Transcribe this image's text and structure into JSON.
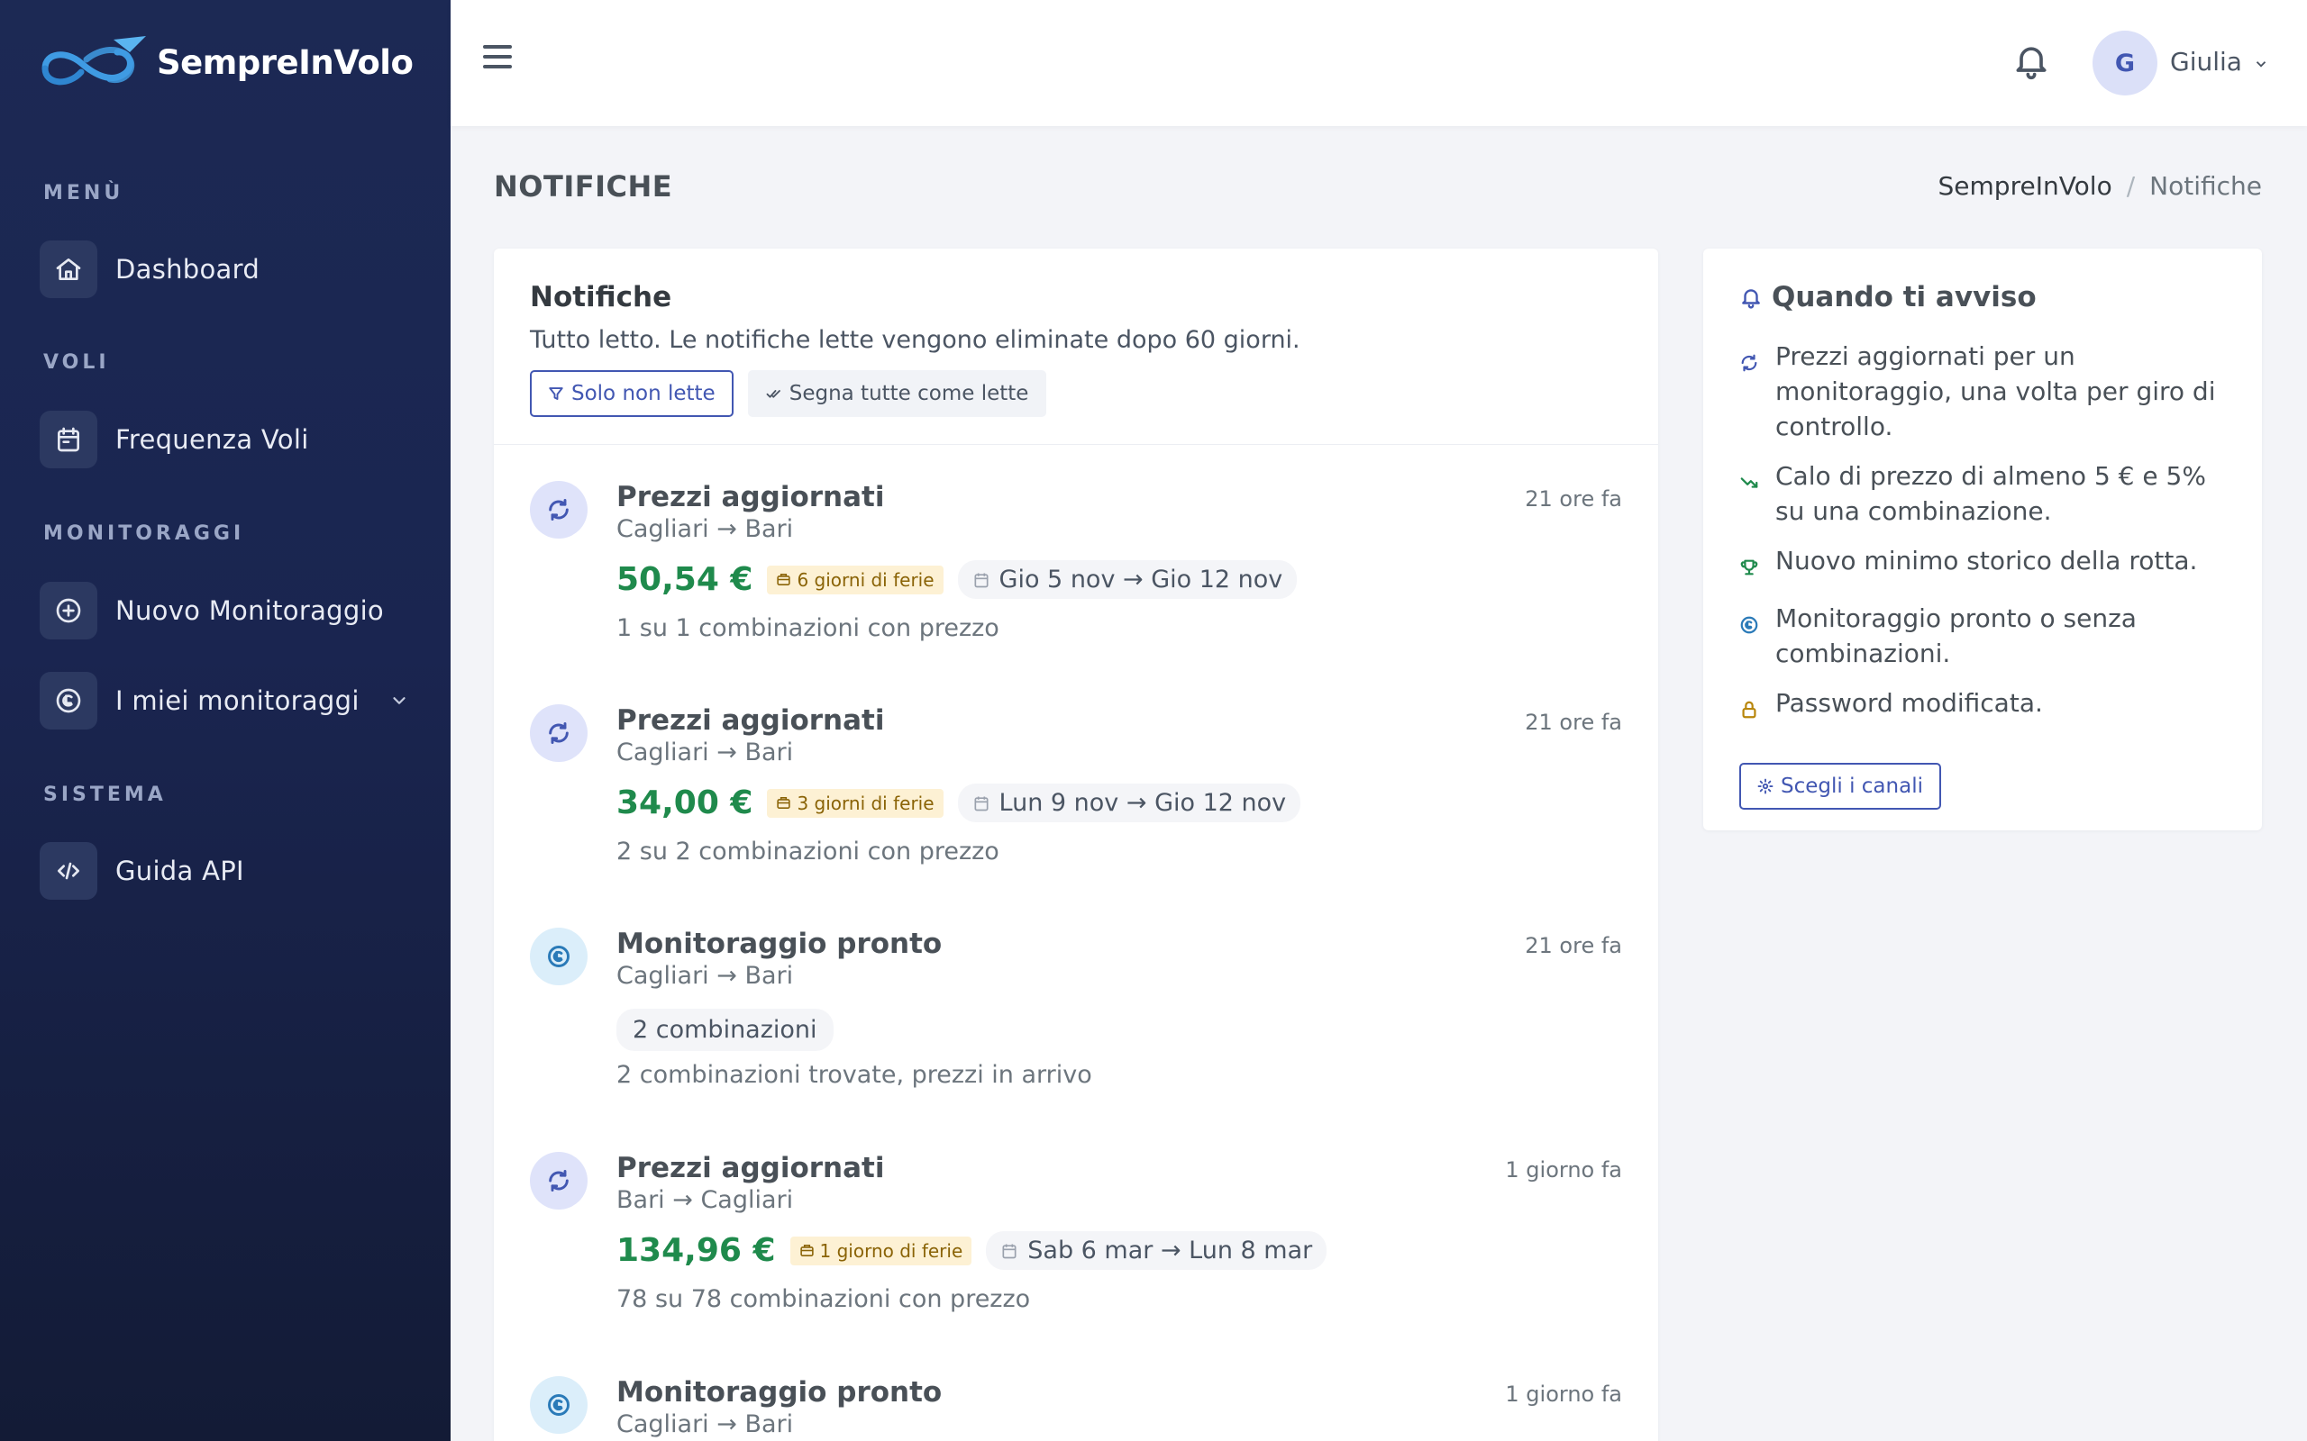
{
  "brand": {
    "name": "SempreInVolo"
  },
  "sidebar": {
    "sections": [
      {
        "title": "MENÙ",
        "items": [
          {
            "label": "Dashboard",
            "icon": "home-icon"
          }
        ]
      },
      {
        "title": "VOLI",
        "items": [
          {
            "label": "Frequenza Voli",
            "icon": "calendar-icon"
          }
        ]
      },
      {
        "title": "MONITORAGGI",
        "items": [
          {
            "label": "Nuovo Monitoraggio",
            "icon": "plus-circle-icon"
          },
          {
            "label": "I miei monitoraggi",
            "icon": "monitor-icon",
            "expandable": true
          }
        ]
      },
      {
        "title": "SISTEMA",
        "items": [
          {
            "label": "Guida API",
            "icon": "code-icon"
          }
        ]
      }
    ]
  },
  "topbar": {
    "user_initial": "G",
    "user_name": "Giulia"
  },
  "page": {
    "title": "NOTIFICHE",
    "breadcrumb": [
      "SempreInVolo",
      "/",
      "Notifiche"
    ]
  },
  "notifications_card": {
    "title": "Notifiche",
    "subtitle": "Tutto letto. Le notifiche lette vengono eliminate dopo 60 giorni.",
    "filter_button": "Solo non lette",
    "mark_all_button": "Segna tutte come lette",
    "items": [
      {
        "type": "updated",
        "title": "Prezzi aggiornati",
        "route": "Cagliari → Bari",
        "time": "21 ore fa",
        "price": "50,54 €",
        "ferie": "6 giorni di ferie",
        "dates": "Gio 5 nov → Gio 12 nov",
        "desc": "1 su 1 combinazioni con prezzo"
      },
      {
        "type": "updated",
        "title": "Prezzi aggiornati",
        "route": "Cagliari → Bari",
        "time": "21 ore fa",
        "price": "34,00 €",
        "ferie": "3 giorni di ferie",
        "dates": "Lun 9 nov → Gio 12 nov",
        "desc": "2 su 2 combinazioni con prezzo"
      },
      {
        "type": "ready",
        "title": "Monitoraggio pronto",
        "route": "Cagliari → Bari",
        "time": "21 ore fa",
        "pill": "2 combinazioni",
        "desc": "2 combinazioni trovate, prezzi in arrivo"
      },
      {
        "type": "updated",
        "title": "Prezzi aggiornati",
        "route": "Bari → Cagliari",
        "time": "1 giorno fa",
        "price": "134,96 €",
        "ferie": "1 giorno di ferie",
        "dates": "Sab 6 mar → Lun 8 mar",
        "desc": "78 su 78 combinazioni con prezzo"
      },
      {
        "type": "ready",
        "title": "Monitoraggio pronto",
        "route": "Cagliari → Bari",
        "time": "1 giorno fa"
      }
    ]
  },
  "side_card": {
    "title": "Quando ti avviso",
    "items": [
      {
        "icon": "refresh-icon",
        "color": "#4257b2",
        "text": "Prezzi aggiornati per un monitoraggio, una volta per giro di controllo."
      },
      {
        "icon": "trend-down-icon",
        "color": "#1f8a4c",
        "text": "Calo di prezzo di almeno 5 € e 5% su una combinazione."
      },
      {
        "icon": "trophy-icon",
        "color": "#1f8a4c",
        "text": "Nuovo minimo storico della rotta."
      },
      {
        "icon": "monitor-icon",
        "color": "#2a7ab8",
        "text": "Monitoraggio pronto o senza combinazioni."
      },
      {
        "icon": "lock-icon",
        "color": "#b8860b",
        "text": "Password modificata."
      }
    ],
    "button": "Scegli i canali"
  },
  "colors": {
    "accent": "#4257b2",
    "price": "#1f8a4c",
    "sidebar": "#1c2954"
  }
}
